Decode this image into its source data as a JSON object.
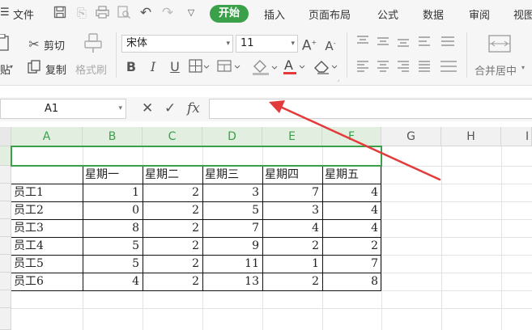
{
  "menu": {
    "file": "文件",
    "tabs": [
      "开始",
      "插入",
      "页面布局",
      "公式",
      "数据",
      "审阅",
      "视图"
    ]
  },
  "toolbar": {
    "cut": "剪切",
    "copy": "复制",
    "paste_partial": "贴",
    "format_painter": "格式刷",
    "font_name": "宋体",
    "font_size": "11",
    "bold": "B",
    "italic": "I",
    "underline": "U",
    "merge_center": "合并居中"
  },
  "formula_bar": {
    "cell_ref": "A1",
    "cancel_icon": "✕",
    "confirm_icon": "✓",
    "fx": "fx",
    "value": ""
  },
  "sheet": {
    "columns": [
      "A",
      "B",
      "C",
      "D",
      "E",
      "F",
      "G",
      "H",
      "I"
    ],
    "headers": [
      "",
      "星期一",
      "星期二",
      "星期三",
      "星期四",
      "星期五"
    ],
    "rows": [
      {
        "name": "员工1",
        "values": [
          "1",
          "2",
          "3",
          "7",
          "4"
        ]
      },
      {
        "name": "员工2",
        "values": [
          "0",
          "2",
          "5",
          "3",
          "4"
        ]
      },
      {
        "name": "员工3",
        "values": [
          "8",
          "2",
          "7",
          "4",
          "4"
        ]
      },
      {
        "name": "员工4",
        "values": [
          "5",
          "2",
          "9",
          "2",
          "2"
        ]
      },
      {
        "name": "员工5",
        "values": [
          "5",
          "2",
          "11",
          "1",
          "7"
        ]
      },
      {
        "name": "员工6",
        "values": [
          "4",
          "2",
          "13",
          "2",
          "8"
        ]
      }
    ]
  },
  "colors": {
    "accent_green": "#3aa04a",
    "annotation_arrow": "#e33b3b"
  }
}
